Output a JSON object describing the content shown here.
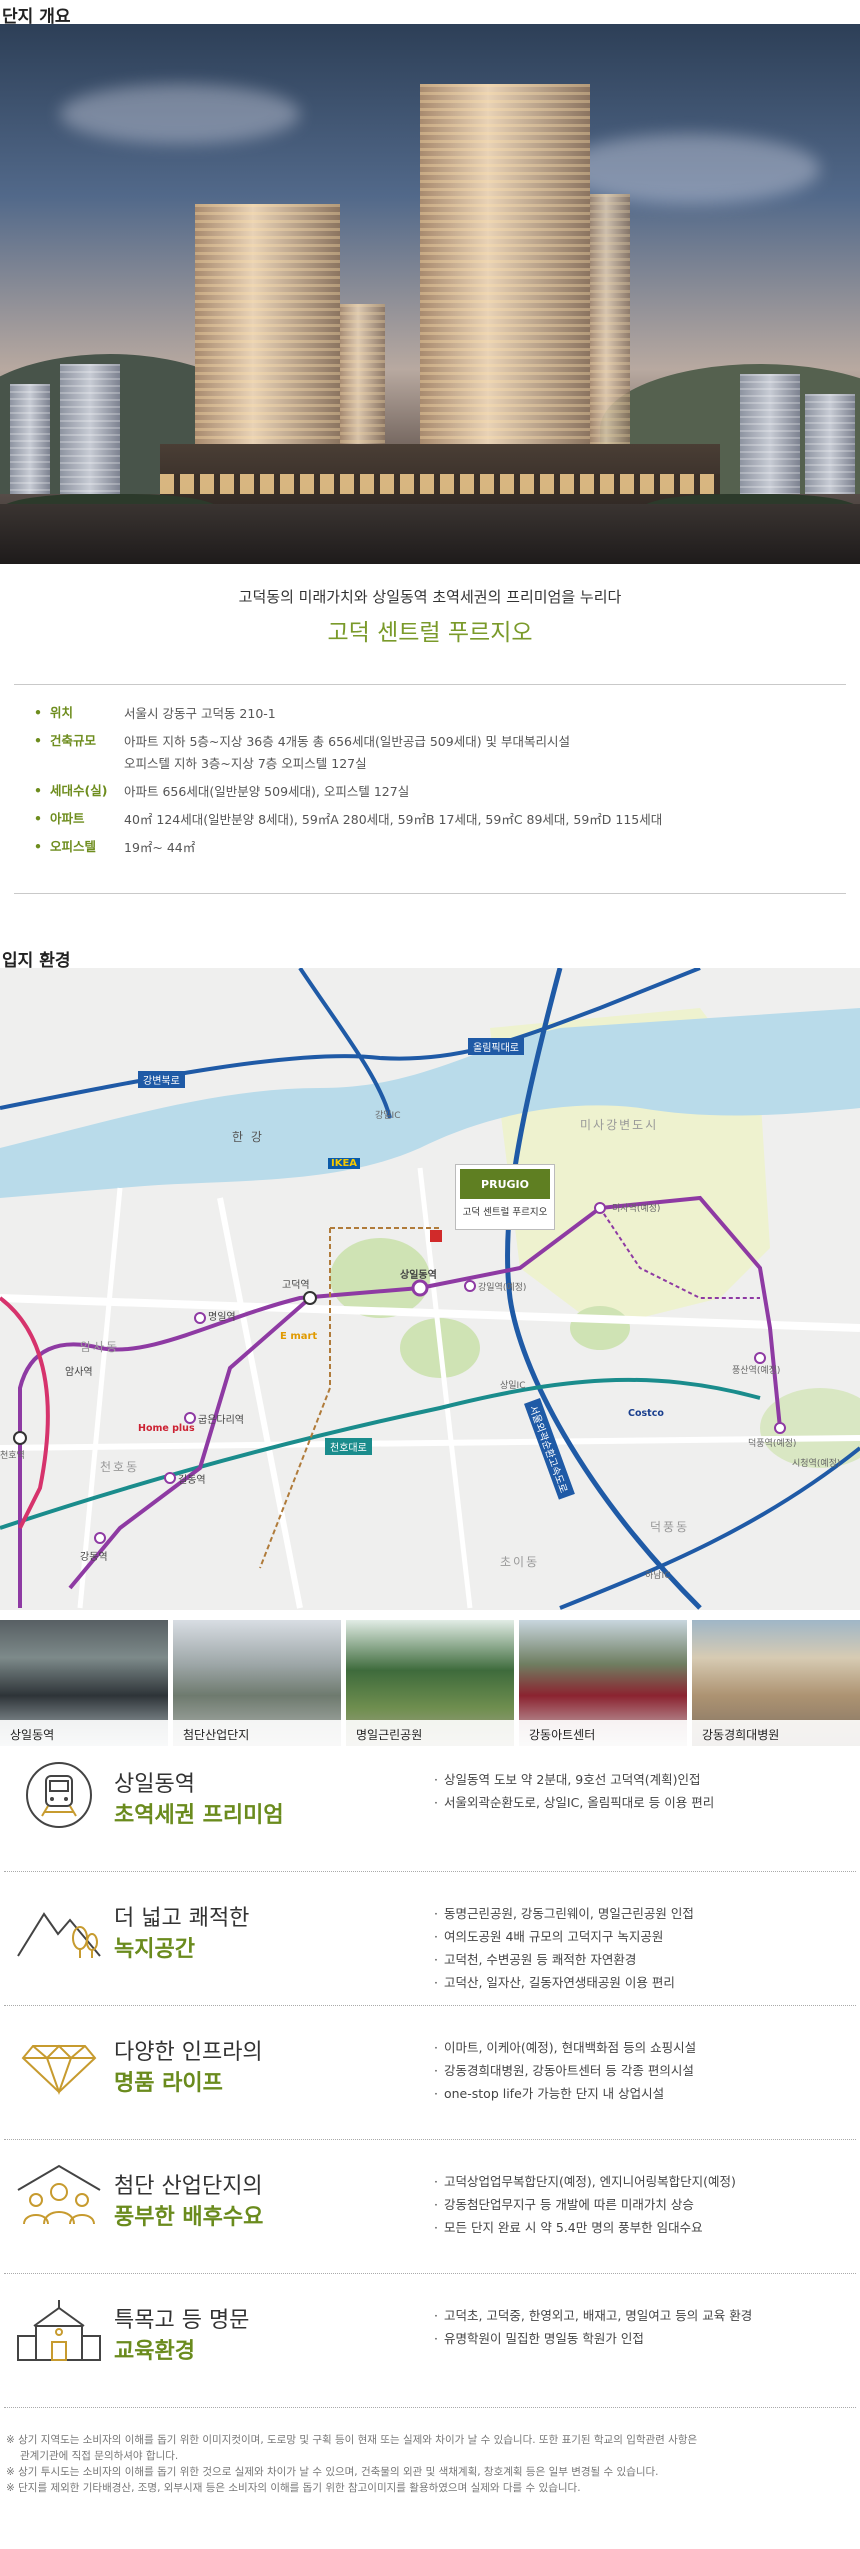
{
  "overview": {
    "section_title": "단지 개요",
    "subtitle": "고덕동의 미래가치와 상일동역 초역세권의 프리미엄을 누리다",
    "title": "고덕 센트럴 푸르지오",
    "rows": [
      {
        "label": "위치",
        "lines": [
          "서울시 강동구 고덕동 210-1"
        ]
      },
      {
        "label": "건축규모",
        "lines": [
          "아파트 지하 5층~지상 36층 4개동 총 656세대(일반공급 509세대) 및 부대복리시설",
          "오피스텔 지하 3층~지상 7층 오피스텔 127실"
        ]
      },
      {
        "label": "세대수(실)",
        "lines": [
          "아파트 656세대(일반분양 509세대), 오피스텔 127실"
        ]
      },
      {
        "label": "아파트",
        "lines": [
          "40㎡ 124세대(일반분양 8세대), 59㎡A 280세대, 59㎡B 17세대, 59㎡C 89세대,  59㎡D 115세대"
        ]
      },
      {
        "label": "오피스텔",
        "lines": [
          "19㎡~ 44㎡"
        ]
      }
    ],
    "accent_color": "#6e8d1e"
  },
  "location": {
    "section_title": "입지 환경",
    "map": {
      "roads": [
        "강변북로",
        "올림픽대로",
        "천호대로",
        "서울외곽순환고속도로"
      ],
      "river": "한 강",
      "project_card": {
        "logo": "PRUGIO",
        "name": "고덕 센트럴 푸르지오"
      },
      "ics": [
        "강일IC",
        "상일IC",
        "하남IC"
      ],
      "stations": [
        "상일동역",
        "고덕역",
        "명일역",
        "굽은다리역",
        "길동역",
        "강동역",
        "암사역",
        "강일역(예정)",
        "미사역(예정)",
        "풍산역(예정)",
        "덕풍역(예정)",
        "시청역(예정)",
        "천호역"
      ],
      "areas": [
        "미사강변도시",
        "암사동",
        "천호동",
        "덕풍동",
        "초이동"
      ],
      "brands": [
        "IKEA",
        "Home plus",
        "E mart",
        "Costco"
      ]
    },
    "photos": [
      "상일동역",
      "첨단산업단지",
      "명일근린공원",
      "강동아트센터",
      "강동경희대병원"
    ]
  },
  "features": [
    {
      "icon": "train-icon",
      "t1": "상일동역",
      "t2": "초역세권 프리미엄",
      "bullets": [
        "상일동역 도보 약 2분대, 9호선 고덕역(계획)인접",
        "서울외곽순환도로, 상일IC, 올림픽대로 등 이용 편리"
      ]
    },
    {
      "icon": "mountain-tree-icon",
      "t1": "더 넓고 쾌적한",
      "t2": "녹지공간",
      "bullets": [
        "동명근린공원, 강동그린웨이, 명일근린공원 인접",
        "여의도공원 4배 규모의 고덕지구 녹지공원",
        "고덕천, 수변공원 등 쾌적한 자연환경",
        "고덕산, 일자산, 길동자연생태공원 이용 편리"
      ]
    },
    {
      "icon": "diamond-icon",
      "t1": "다양한 인프라의",
      "t2": "명품 라이프",
      "bullets": [
        "이마트, 이케아(예정), 현대백화점 등의 쇼핑시설",
        "강동경희대병원, 강동아트센터 등 각종 편의시설",
        "one-stop life가 가능한 단지 내 상업시설"
      ]
    },
    {
      "icon": "people-icon",
      "t1": "첨단 산업단지의",
      "t2": "풍부한 배후수요",
      "bullets": [
        "고덕상업업무복합단지(예정), 엔지니어링복합단지(예정)",
        "강동첨단업무지구 등 개발에 따른 미래가치 상승",
        "모든 단지 완료 시 약 5.4만 명의 풍부한 임대수요"
      ]
    },
    {
      "icon": "school-icon",
      "t1": "특목고 등 명문",
      "t2": "교육환경",
      "bullets": [
        "고덕초, 고덕중, 한영외고, 배재고, 명일여고 등의 교육 환경",
        "유명학원이 밀집한 명일동 학원가 인접"
      ]
    }
  ],
  "notes": [
    "※ 상기 지역도는 소비자의 이해를 돕기 위한 이미지컷이며, 도로망 및 구획 등이 현재 또는 실제와 차이가 날 수 있습니다. 또한 표기된 학교의 입학관련 사항은",
    "    관계기관에 직접 문의하셔야 합니다.",
    "※ 상기 투시도는 소비자의 이해를 돕기 위한 것으로 실제와 차이가 날 수 있으며, 건축물의 외관 및 색채계획, 창호계획 등은 일부 변경될 수 있습니다.",
    "※ 단지를 제외한 기타배경산, 조명, 외부시재 등은 소비자의 이해를 돕기 위한 참고이미지를 활용하였으며 실제와 다를 수 있습니다."
  ]
}
